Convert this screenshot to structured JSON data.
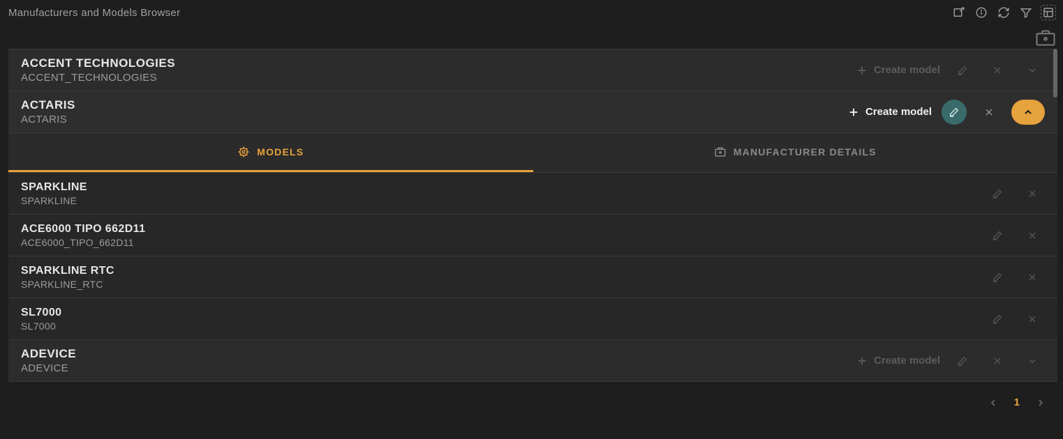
{
  "header": {
    "title": "Manufacturers and Models Browser"
  },
  "actions": {
    "create_model": "Create model"
  },
  "tabs": {
    "models": "MODELS",
    "details": "MANUFACTURER DETAILS"
  },
  "manufacturers": [
    {
      "display_name": "ACCENT TECHNOLOGIES",
      "code": "ACCENT_TECHNOLOGIES",
      "expanded": false
    },
    {
      "display_name": "ACTARIS",
      "code": "ACTARIS",
      "expanded": true,
      "models": [
        {
          "display_name": "SPARKLINE",
          "code": "SPARKLINE"
        },
        {
          "display_name": "ACE6000 TIPO 662D11",
          "code": "ACE6000_TIPO_662D11"
        },
        {
          "display_name": "SPARKLINE RTC",
          "code": "SPARKLINE_RTC"
        },
        {
          "display_name": "SL7000",
          "code": "SL7000"
        }
      ]
    },
    {
      "display_name": "ADEVICE",
      "code": "ADEVICE",
      "expanded": false
    }
  ],
  "pager": {
    "current": "1"
  }
}
